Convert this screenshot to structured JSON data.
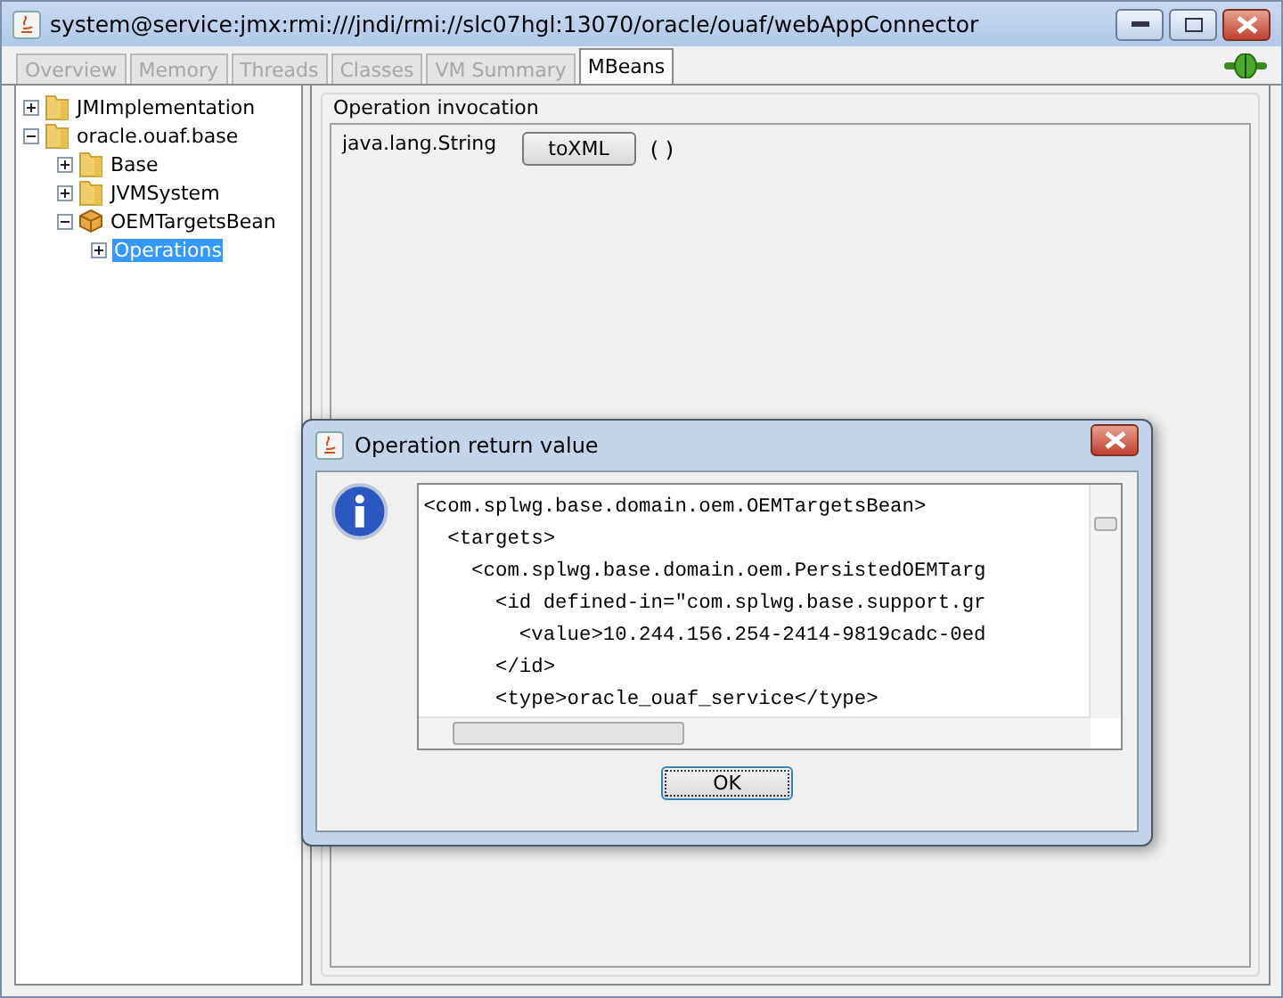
{
  "window": {
    "title": "system@service:jmx:rmi:///jndi/rmi://slc07hgl:13070/oracle/ouaf/webAppConnector"
  },
  "tabs": [
    {
      "label": "Overview",
      "selected": false,
      "disabled": true
    },
    {
      "label": "Memory",
      "selected": false,
      "disabled": true
    },
    {
      "label": "Threads",
      "selected": false,
      "disabled": true
    },
    {
      "label": "Classes",
      "selected": false,
      "disabled": true
    },
    {
      "label": "VM Summary",
      "selected": false,
      "disabled": true
    },
    {
      "label": "MBeans",
      "selected": true,
      "disabled": false
    }
  ],
  "tree": [
    {
      "label": "JMImplementation",
      "kind": "folder",
      "expanded": false,
      "selected": false
    },
    {
      "label": "oracle.ouaf.base",
      "kind": "folder",
      "expanded": true,
      "selected": false,
      "children": [
        {
          "label": "Base",
          "kind": "folder",
          "expanded": false,
          "selected": false
        },
        {
          "label": "JVMSystem",
          "kind": "folder",
          "expanded": false,
          "selected": false
        },
        {
          "label": "OEMTargetsBean",
          "kind": "bean",
          "expanded": true,
          "selected": false,
          "children": [
            {
              "label": "Operations",
              "expanded": false,
              "selected": true
            }
          ]
        }
      ]
    }
  ],
  "invocation": {
    "title": "Operation invocation",
    "return_type": "java.lang.String",
    "button": "toXML",
    "params": "( )"
  },
  "dialog": {
    "title": "Operation return value",
    "lines": [
      "<com.splwg.base.domain.oem.OEMTargetsBean>",
      "  <targets>",
      "    <com.splwg.base.domain.oem.PersistedOEMTarg",
      "      <id defined-in=\"com.splwg.base.support.gr",
      "        <value>10.244.156.254-2414-9819cadc-0ed",
      "      </id>",
      "      <type>oracle_ouaf_service</type>"
    ],
    "button": "OK"
  }
}
